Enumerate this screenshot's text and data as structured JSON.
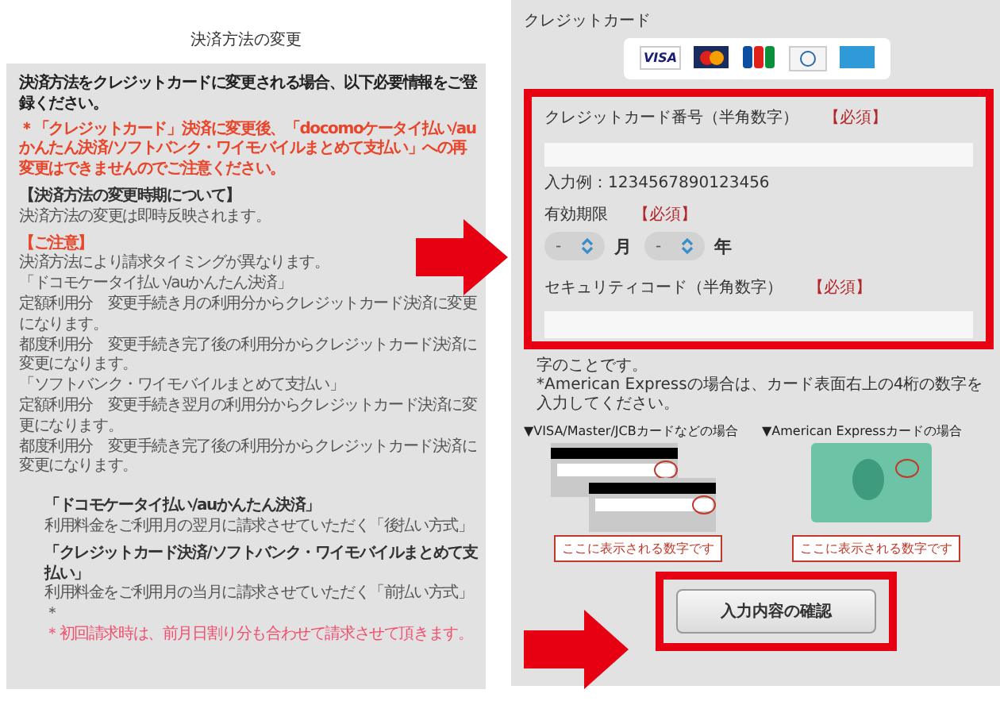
{
  "left_panel": {
    "title": "決済方法の変更",
    "notes": [
      {
        "kind": "lead",
        "text": "決済方法をクレジットカードに変更される場合、以下必要情報をご登録ください。"
      },
      {
        "kind": "warning",
        "text": "＊「クレジットカード」決済に変更後、「docomoケータイ払い/auかんたん決済/ソフトバンク・ワイモバイルまとめて支払い」への再変更はできませんのでご注意ください。"
      },
      {
        "kind": "heading",
        "text": "【決済方法の変更時期について】"
      },
      {
        "kind": "text",
        "text": "決済方法の変更は即時反映されます。"
      },
      {
        "kind": "alert",
        "text": "【ご注意】"
      },
      {
        "kind": "line",
        "text": "決済方法により請求タイミングが異なります。"
      },
      {
        "kind": "line",
        "text": "「ドコモケータイ払い/auかんたん決済」"
      },
      {
        "kind": "line",
        "text": "定額利用分　変更手続き月の利用分からクレジットカード決済に変更になります。"
      },
      {
        "kind": "line",
        "text": "都度利用分　変更手続き完了後の利用分からクレジットカード決済に変更になります。"
      },
      {
        "kind": "line",
        "text": "「ソフトバンク・ワイモバイルまとめて支払い」"
      },
      {
        "kind": "line",
        "text": "定額利用分　変更手続き翌月の利用分からクレジットカード決済に変更になります。"
      },
      {
        "kind": "line",
        "text": "都度利用分　変更手続き完了後の利用分からクレジットカード決済に変更になります。"
      },
      {
        "kind": "term",
        "text": "「ドコモケータイ払い/auかんたん決済」"
      },
      {
        "kind": "detail",
        "text": "利用料金をご利用月の翌月に請求させていただく「後払い方式」"
      },
      {
        "kind": "term",
        "text": "「クレジットカード決済/ソフトバンク・ワイモバイルまとめて支払い」"
      },
      {
        "kind": "detail",
        "text": "利用料金をご利用月の当月に請求させていただく「前払い方式」＊"
      },
      {
        "kind": "footnote",
        "text": "＊初回請求時は、前月日割り分も合わせて請求させて頂きます。"
      }
    ]
  },
  "right_panel": {
    "title": "クレジットカード",
    "card_logos": [
      {
        "kind": "visa",
        "label": "VISA"
      },
      {
        "kind": "mastercard"
      },
      {
        "kind": "jcb"
      },
      {
        "kind": "diners"
      },
      {
        "kind": "amex"
      }
    ],
    "card_number": {
      "label": "クレジットカード番号（半角数字）",
      "required": "【必須】",
      "hint": "入力例：1234567890123456"
    },
    "expiry": {
      "label": "有効期限",
      "required": "【必須】",
      "selects": [
        {
          "value": "-",
          "unit": "月"
        },
        {
          "value": "-",
          "unit": "年"
        }
      ]
    },
    "security_code": {
      "label": "セキュリティコード（半角数字）",
      "required": "【必須】"
    },
    "notes": [
      "字のことです。",
      "*American Expressの場合は、カード表面右上の4桁の数字を入力してください。"
    ],
    "examples": [
      {
        "kind": "back",
        "caption": "▼VISA/Master/JCBカードなどの場合",
        "callout": "ここに表示される数字です"
      },
      {
        "kind": "front",
        "caption": "▼American Expressカードの場合",
        "callout": "ここに表示される数字です"
      }
    ],
    "button": "入力内容の確認"
  }
}
